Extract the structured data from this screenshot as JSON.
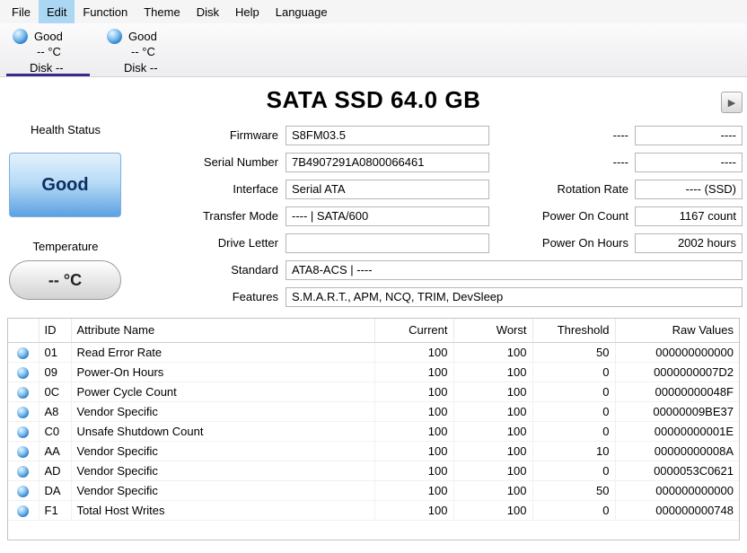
{
  "colors": {
    "orb_blue": "#2e7ecb",
    "selected_tab_underline": "#3b2a8c",
    "health_good_fill": "#5ba1e2",
    "health_good_text": "#0b2e63",
    "menu_highlight": "#abd7f3"
  },
  "icons": {
    "play": "▶",
    "disk_status_orb": "blue-sphere",
    "attribute_status_orb": "blue-sphere"
  },
  "menu": {
    "items": [
      "File",
      "Edit",
      "Function",
      "Theme",
      "Disk",
      "Help",
      "Language"
    ],
    "active_item": "Edit"
  },
  "disk_tabs": [
    {
      "status": "Good",
      "temperature": "-- °C",
      "label": "Disk --",
      "selected": true
    },
    {
      "status": "Good",
      "temperature": "-- °C",
      "label": "Disk --",
      "selected": false
    }
  ],
  "drive": {
    "title": "SATA SSD 64.0 GB",
    "health": {
      "label": "Health Status",
      "status": "Good"
    },
    "temperature": {
      "label": "Temperature",
      "value": "-- °C"
    },
    "fields_middle": [
      {
        "label": "Firmware",
        "value": "S8FM03.5"
      },
      {
        "label": "Serial Number",
        "value": "7B4907291A0800066461"
      },
      {
        "label": "Interface",
        "value": "Serial ATA"
      },
      {
        "label": "Transfer Mode",
        "value": "---- | SATA/600"
      },
      {
        "label": "Drive Letter",
        "value": ""
      },
      {
        "label": "Standard",
        "value": "ATA8-ACS | ----"
      },
      {
        "label": "Features",
        "value": "S.M.A.R.T., APM, NCQ, TRIM, DevSleep"
      }
    ],
    "fields_right": [
      {
        "label": "----",
        "value": "----"
      },
      {
        "label": "----",
        "value": "----"
      },
      {
        "label": "Rotation Rate",
        "value": "---- (SSD)"
      },
      {
        "label": "Power On Count",
        "value": "1167 count"
      },
      {
        "label": "Power On Hours",
        "value": "2002 hours"
      }
    ]
  },
  "smart_table": {
    "headers": {
      "id": "ID",
      "name": "Attribute Name",
      "current": "Current",
      "worst": "Worst",
      "threshold": "Threshold",
      "raw": "Raw Values"
    },
    "rows": [
      {
        "id": "01",
        "name": "Read Error Rate",
        "current": "100",
        "worst": "100",
        "threshold": "50",
        "raw": "000000000000"
      },
      {
        "id": "09",
        "name": "Power-On Hours",
        "current": "100",
        "worst": "100",
        "threshold": "0",
        "raw": "0000000007D2"
      },
      {
        "id": "0C",
        "name": "Power Cycle Count",
        "current": "100",
        "worst": "100",
        "threshold": "0",
        "raw": "00000000048F"
      },
      {
        "id": "A8",
        "name": "Vendor Specific",
        "current": "100",
        "worst": "100",
        "threshold": "0",
        "raw": "00000009BE37"
      },
      {
        "id": "C0",
        "name": "Unsafe Shutdown Count",
        "current": "100",
        "worst": "100",
        "threshold": "0",
        "raw": "00000000001E"
      },
      {
        "id": "AA",
        "name": "Vendor Specific",
        "current": "100",
        "worst": "100",
        "threshold": "10",
        "raw": "00000000008A"
      },
      {
        "id": "AD",
        "name": "Vendor Specific",
        "current": "100",
        "worst": "100",
        "threshold": "0",
        "raw": "0000053C0621"
      },
      {
        "id": "DA",
        "name": "Vendor Specific",
        "current": "100",
        "worst": "100",
        "threshold": "50",
        "raw": "000000000000"
      },
      {
        "id": "F1",
        "name": "Total Host Writes",
        "current": "100",
        "worst": "100",
        "threshold": "0",
        "raw": "000000000748"
      }
    ]
  }
}
